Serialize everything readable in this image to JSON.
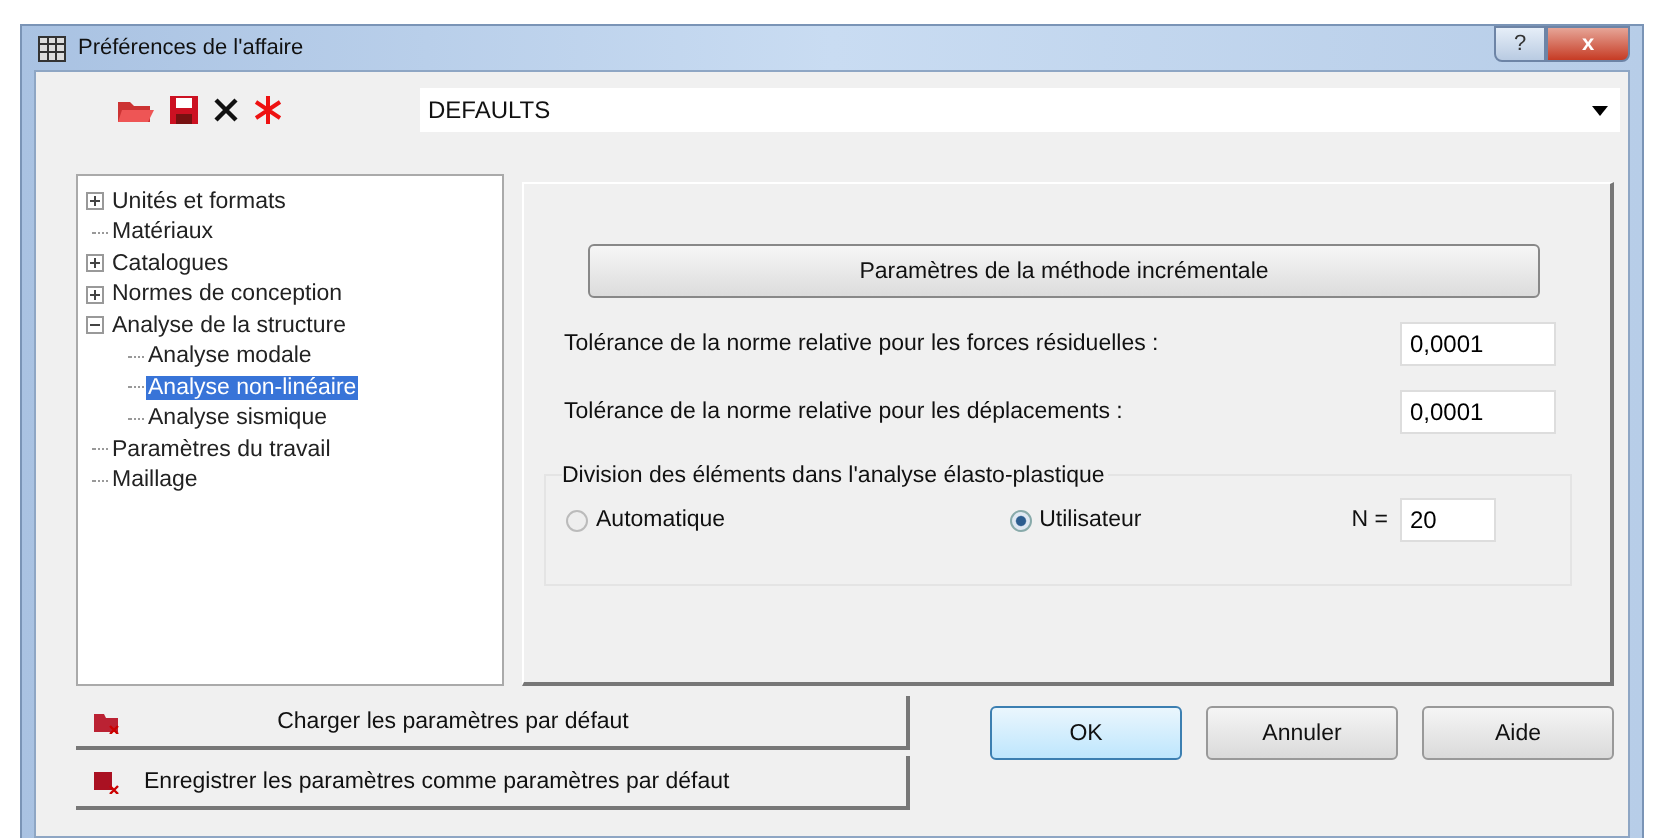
{
  "window": {
    "title": "Préférences de l'affaire",
    "help_button": "?",
    "close_button": "x"
  },
  "toolbar": {
    "combo_value": "DEFAULTS"
  },
  "tree": [
    {
      "label": "Unités et formats",
      "expanded": false,
      "selected": false
    },
    {
      "label": "Matériaux",
      "selected": false
    },
    {
      "label": "Catalogues",
      "expanded": false,
      "selected": false
    },
    {
      "label": "Normes de conception",
      "expanded": false,
      "selected": false
    },
    {
      "label": "Analyse de la structure",
      "expanded": true,
      "selected": false,
      "children": [
        {
          "label": "Analyse modale",
          "selected": false
        },
        {
          "label": "Analyse non-linéaire",
          "selected": true
        },
        {
          "label": "Analyse sismique",
          "selected": false
        }
      ]
    },
    {
      "label": "Paramètres du travail",
      "selected": false
    },
    {
      "label": "Maillage",
      "selected": false
    }
  ],
  "panel": {
    "method_button": "Paramètres de la méthode incrémentale",
    "fields": [
      {
        "label": "Tolérance de la norme relative pour les forces résiduelles :",
        "value": "0,0001"
      },
      {
        "label": "Tolérance de la norme relative pour les déplacements :",
        "value": "0,0001"
      }
    ],
    "division": {
      "title": "Division des éléments dans l'analyse élasto-plastique",
      "options": [
        {
          "label": "Automatique",
          "selected": false
        },
        {
          "label": "Utilisateur",
          "selected": true
        }
      ],
      "n_label": "N =",
      "n_value": "20"
    }
  },
  "default_buttons": [
    "Charger les paramètres par défaut",
    "Enregistrer les paramètres comme paramètres par défaut"
  ],
  "buttons": [
    "OK",
    "Annuler",
    "Aide"
  ]
}
